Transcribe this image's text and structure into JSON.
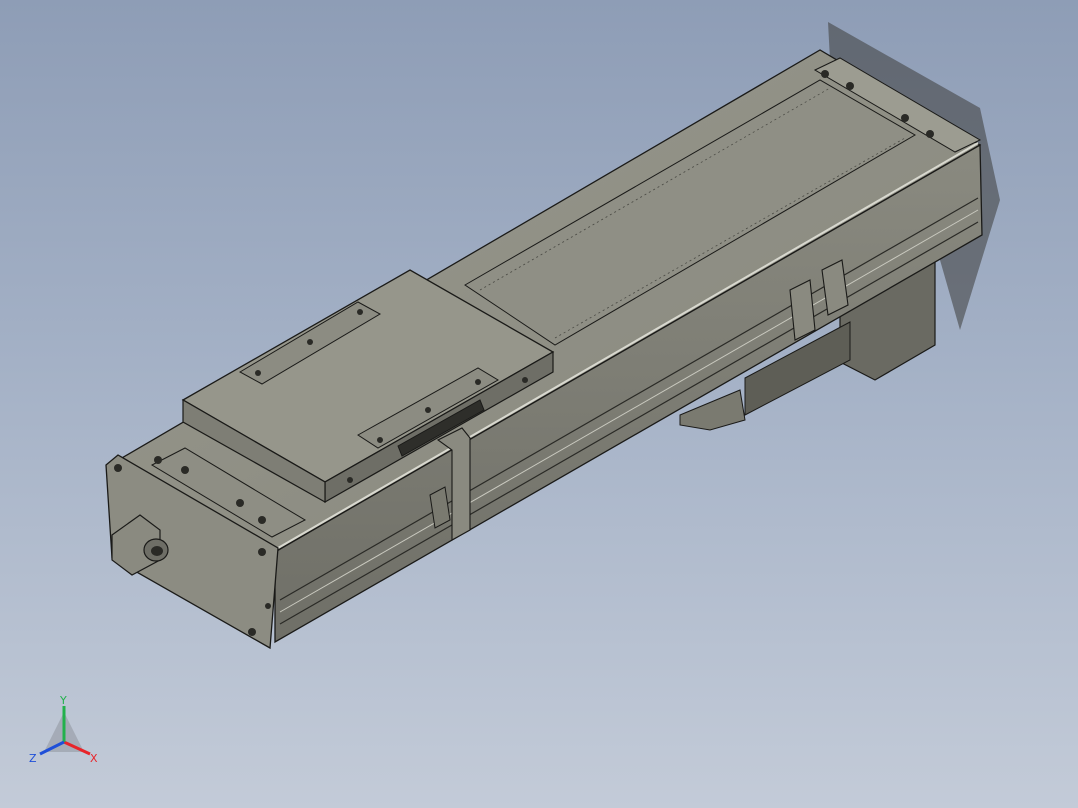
{
  "triad": {
    "x_label": "X",
    "y_label": "Y",
    "z_label": "Z",
    "x_color": "#e8242a",
    "y_color": "#22b14c",
    "z_color": "#1f4fd8"
  },
  "colors": {
    "background_top": "#8e9db6",
    "background_bottom": "#c3cbd8",
    "part_light": "#9c9c90",
    "part_mid": "#84847a",
    "part_dark": "#5e5e56",
    "edge": "#1a1a18"
  }
}
